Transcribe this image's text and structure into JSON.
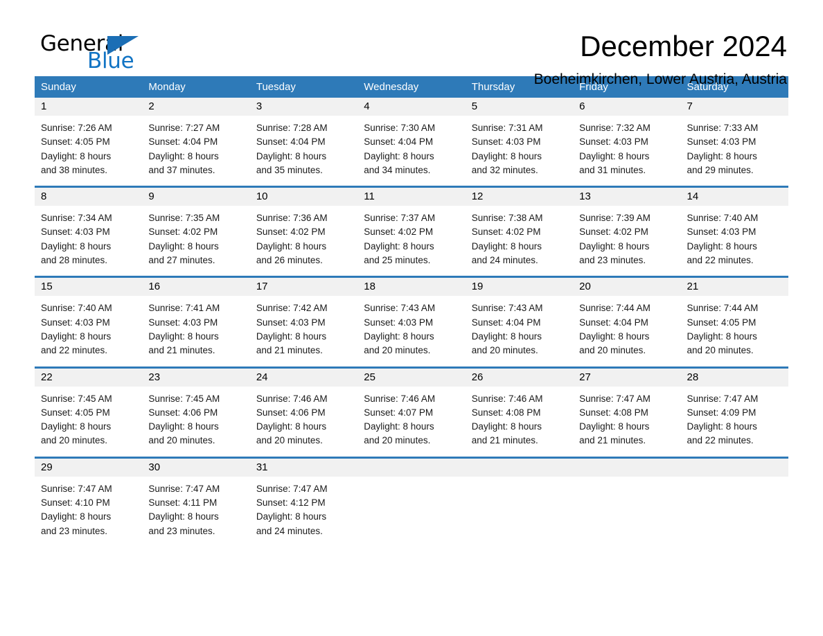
{
  "brand": {
    "name_part1": "General",
    "name_part2": "Blue",
    "accent_color": "#1b6eb5"
  },
  "header": {
    "title": "December 2024",
    "subtitle": "Boeheimkirchen, Lower Austria, Austria"
  },
  "calendar": {
    "header_bg": "#2e7ab8",
    "daynum_bg": "#f1f1f1",
    "weekdays": [
      "Sunday",
      "Monday",
      "Tuesday",
      "Wednesday",
      "Thursday",
      "Friday",
      "Saturday"
    ],
    "weeks": [
      [
        {
          "day": "1",
          "lines": [
            "Sunrise: 7:26 AM",
            "Sunset: 4:05 PM",
            "Daylight: 8 hours",
            "and 38 minutes."
          ]
        },
        {
          "day": "2",
          "lines": [
            "Sunrise: 7:27 AM",
            "Sunset: 4:04 PM",
            "Daylight: 8 hours",
            "and 37 minutes."
          ]
        },
        {
          "day": "3",
          "lines": [
            "Sunrise: 7:28 AM",
            "Sunset: 4:04 PM",
            "Daylight: 8 hours",
            "and 35 minutes."
          ]
        },
        {
          "day": "4",
          "lines": [
            "Sunrise: 7:30 AM",
            "Sunset: 4:04 PM",
            "Daylight: 8 hours",
            "and 34 minutes."
          ]
        },
        {
          "day": "5",
          "lines": [
            "Sunrise: 7:31 AM",
            "Sunset: 4:03 PM",
            "Daylight: 8 hours",
            "and 32 minutes."
          ]
        },
        {
          "day": "6",
          "lines": [
            "Sunrise: 7:32 AM",
            "Sunset: 4:03 PM",
            "Daylight: 8 hours",
            "and 31 minutes."
          ]
        },
        {
          "day": "7",
          "lines": [
            "Sunrise: 7:33 AM",
            "Sunset: 4:03 PM",
            "Daylight: 8 hours",
            "and 29 minutes."
          ]
        }
      ],
      [
        {
          "day": "8",
          "lines": [
            "Sunrise: 7:34 AM",
            "Sunset: 4:03 PM",
            "Daylight: 8 hours",
            "and 28 minutes."
          ]
        },
        {
          "day": "9",
          "lines": [
            "Sunrise: 7:35 AM",
            "Sunset: 4:02 PM",
            "Daylight: 8 hours",
            "and 27 minutes."
          ]
        },
        {
          "day": "10",
          "lines": [
            "Sunrise: 7:36 AM",
            "Sunset: 4:02 PM",
            "Daylight: 8 hours",
            "and 26 minutes."
          ]
        },
        {
          "day": "11",
          "lines": [
            "Sunrise: 7:37 AM",
            "Sunset: 4:02 PM",
            "Daylight: 8 hours",
            "and 25 minutes."
          ]
        },
        {
          "day": "12",
          "lines": [
            "Sunrise: 7:38 AM",
            "Sunset: 4:02 PM",
            "Daylight: 8 hours",
            "and 24 minutes."
          ]
        },
        {
          "day": "13",
          "lines": [
            "Sunrise: 7:39 AM",
            "Sunset: 4:02 PM",
            "Daylight: 8 hours",
            "and 23 minutes."
          ]
        },
        {
          "day": "14",
          "lines": [
            "Sunrise: 7:40 AM",
            "Sunset: 4:03 PM",
            "Daylight: 8 hours",
            "and 22 minutes."
          ]
        }
      ],
      [
        {
          "day": "15",
          "lines": [
            "Sunrise: 7:40 AM",
            "Sunset: 4:03 PM",
            "Daylight: 8 hours",
            "and 22 minutes."
          ]
        },
        {
          "day": "16",
          "lines": [
            "Sunrise: 7:41 AM",
            "Sunset: 4:03 PM",
            "Daylight: 8 hours",
            "and 21 minutes."
          ]
        },
        {
          "day": "17",
          "lines": [
            "Sunrise: 7:42 AM",
            "Sunset: 4:03 PM",
            "Daylight: 8 hours",
            "and 21 minutes."
          ]
        },
        {
          "day": "18",
          "lines": [
            "Sunrise: 7:43 AM",
            "Sunset: 4:03 PM",
            "Daylight: 8 hours",
            "and 20 minutes."
          ]
        },
        {
          "day": "19",
          "lines": [
            "Sunrise: 7:43 AM",
            "Sunset: 4:04 PM",
            "Daylight: 8 hours",
            "and 20 minutes."
          ]
        },
        {
          "day": "20",
          "lines": [
            "Sunrise: 7:44 AM",
            "Sunset: 4:04 PM",
            "Daylight: 8 hours",
            "and 20 minutes."
          ]
        },
        {
          "day": "21",
          "lines": [
            "Sunrise: 7:44 AM",
            "Sunset: 4:05 PM",
            "Daylight: 8 hours",
            "and 20 minutes."
          ]
        }
      ],
      [
        {
          "day": "22",
          "lines": [
            "Sunrise: 7:45 AM",
            "Sunset: 4:05 PM",
            "Daylight: 8 hours",
            "and 20 minutes."
          ]
        },
        {
          "day": "23",
          "lines": [
            "Sunrise: 7:45 AM",
            "Sunset: 4:06 PM",
            "Daylight: 8 hours",
            "and 20 minutes."
          ]
        },
        {
          "day": "24",
          "lines": [
            "Sunrise: 7:46 AM",
            "Sunset: 4:06 PM",
            "Daylight: 8 hours",
            "and 20 minutes."
          ]
        },
        {
          "day": "25",
          "lines": [
            "Sunrise: 7:46 AM",
            "Sunset: 4:07 PM",
            "Daylight: 8 hours",
            "and 20 minutes."
          ]
        },
        {
          "day": "26",
          "lines": [
            "Sunrise: 7:46 AM",
            "Sunset: 4:08 PM",
            "Daylight: 8 hours",
            "and 21 minutes."
          ]
        },
        {
          "day": "27",
          "lines": [
            "Sunrise: 7:47 AM",
            "Sunset: 4:08 PM",
            "Daylight: 8 hours",
            "and 21 minutes."
          ]
        },
        {
          "day": "28",
          "lines": [
            "Sunrise: 7:47 AM",
            "Sunset: 4:09 PM",
            "Daylight: 8 hours",
            "and 22 minutes."
          ]
        }
      ],
      [
        {
          "day": "29",
          "lines": [
            "Sunrise: 7:47 AM",
            "Sunset: 4:10 PM",
            "Daylight: 8 hours",
            "and 23 minutes."
          ]
        },
        {
          "day": "30",
          "lines": [
            "Sunrise: 7:47 AM",
            "Sunset: 4:11 PM",
            "Daylight: 8 hours",
            "and 23 minutes."
          ]
        },
        {
          "day": "31",
          "lines": [
            "Sunrise: 7:47 AM",
            "Sunset: 4:12 PM",
            "Daylight: 8 hours",
            "and 24 minutes."
          ]
        },
        {
          "day": "",
          "lines": []
        },
        {
          "day": "",
          "lines": []
        },
        {
          "day": "",
          "lines": []
        },
        {
          "day": "",
          "lines": []
        }
      ]
    ]
  }
}
